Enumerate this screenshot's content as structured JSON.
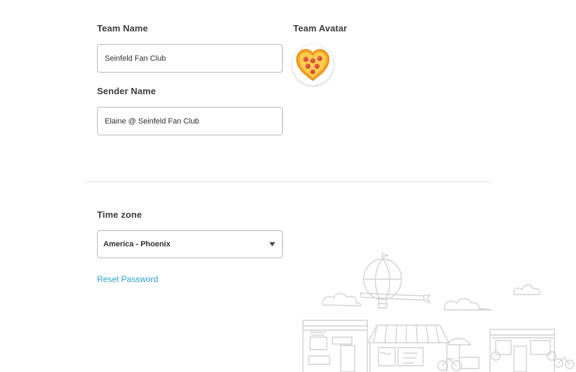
{
  "team": {
    "name_label": "Team Name",
    "name_value": "Seinfeld Fan Club",
    "avatar_label": "Team Avatar",
    "avatar_icon": "pizza-heart-icon"
  },
  "sender": {
    "label": "Sender Name",
    "value": "Elaine @ Seinfeld Fan Club"
  },
  "timezone": {
    "label": "Time zone",
    "selected": "America - Phoenix"
  },
  "reset_password": "Reset Password",
  "colors": {
    "link": "#2a9fd6",
    "border": "#b9b9b9",
    "divider": "#dcdcdc",
    "illustration": "#d2d2d2"
  }
}
